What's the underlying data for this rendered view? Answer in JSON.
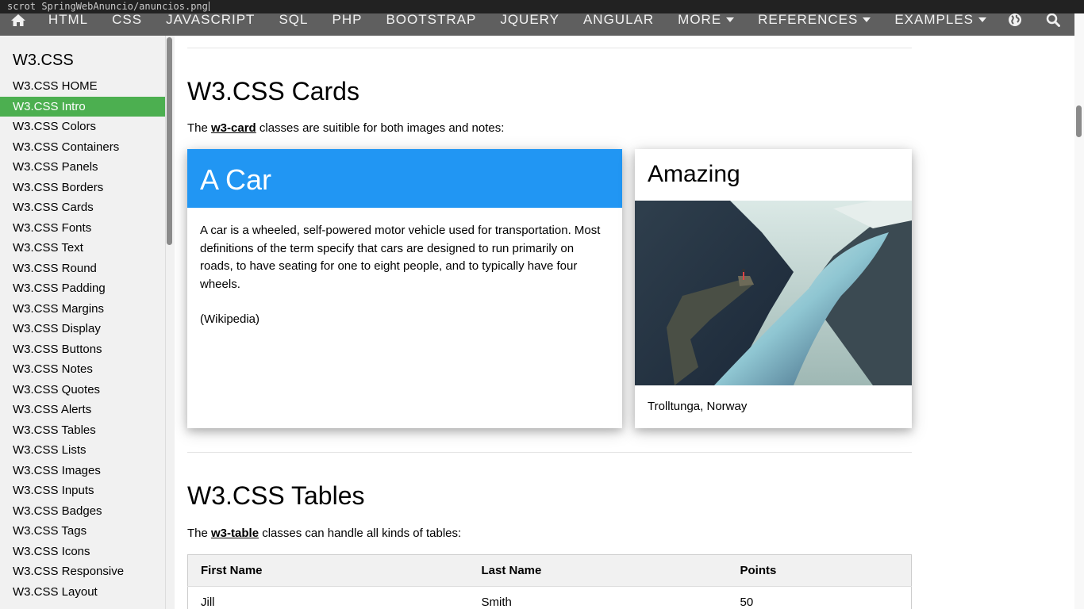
{
  "terminal": {
    "command": "scrot SpringWebAnuncio/anuncios.png"
  },
  "nav": {
    "items": [
      "HTML",
      "CSS",
      "JAVASCRIPT",
      "SQL",
      "PHP",
      "BOOTSTRAP",
      "JQUERY",
      "ANGULAR"
    ],
    "more": "MORE",
    "references": "REFERENCES",
    "examples": "EXAMPLES"
  },
  "sidebar": {
    "title": "W3.CSS",
    "items": [
      {
        "label": "W3.CSS HOME"
      },
      {
        "label": "W3.CSS Intro",
        "active": true
      },
      {
        "label": "W3.CSS Colors"
      },
      {
        "label": "W3.CSS Containers"
      },
      {
        "label": "W3.CSS Panels"
      },
      {
        "label": "W3.CSS Borders"
      },
      {
        "label": "W3.CSS Cards"
      },
      {
        "label": "W3.CSS Fonts"
      },
      {
        "label": "W3.CSS Text"
      },
      {
        "label": "W3.CSS Round"
      },
      {
        "label": "W3.CSS Padding"
      },
      {
        "label": "W3.CSS Margins"
      },
      {
        "label": "W3.CSS Display"
      },
      {
        "label": "W3.CSS Buttons"
      },
      {
        "label": "W3.CSS Notes"
      },
      {
        "label": "W3.CSS Quotes"
      },
      {
        "label": "W3.CSS Alerts"
      },
      {
        "label": "W3.CSS Tables"
      },
      {
        "label": "W3.CSS Lists"
      },
      {
        "label": "W3.CSS Images"
      },
      {
        "label": "W3.CSS Inputs"
      },
      {
        "label": "W3.CSS Badges"
      },
      {
        "label": "W3.CSS Tags"
      },
      {
        "label": "W3.CSS Icons"
      },
      {
        "label": "W3.CSS Responsive"
      },
      {
        "label": "W3.CSS Layout"
      }
    ]
  },
  "cards_section": {
    "title": "W3.CSS Cards",
    "intro_before": "The ",
    "intro_code": "w3-card",
    "intro_after": " classes are suitible for both images and notes:",
    "car_card": {
      "title": "A Car",
      "text": "A car is a wheeled, self-powered motor vehicle used for transportation. Most definitions of the term specify that cars are designed to run primarily on roads, to have seating for one to eight people, and to typically have four wheels.",
      "source": "(Wikipedia)"
    },
    "image_card": {
      "title": "Amazing",
      "caption": "Trolltunga, Norway"
    }
  },
  "tables_section": {
    "title": "W3.CSS Tables",
    "intro_before": "The ",
    "intro_code": "w3-table",
    "intro_after": " classes can handle all kinds of tables:",
    "headers": [
      "First Name",
      "Last Name",
      "Points"
    ],
    "rows": [
      [
        "Jill",
        "Smith",
        "50"
      ]
    ]
  },
  "colors": {
    "nav_bg": "#5f5f5f",
    "active_green": "#4caf50",
    "card_blue": "#2196f3",
    "sidebar_bg": "#f1f1f1"
  }
}
